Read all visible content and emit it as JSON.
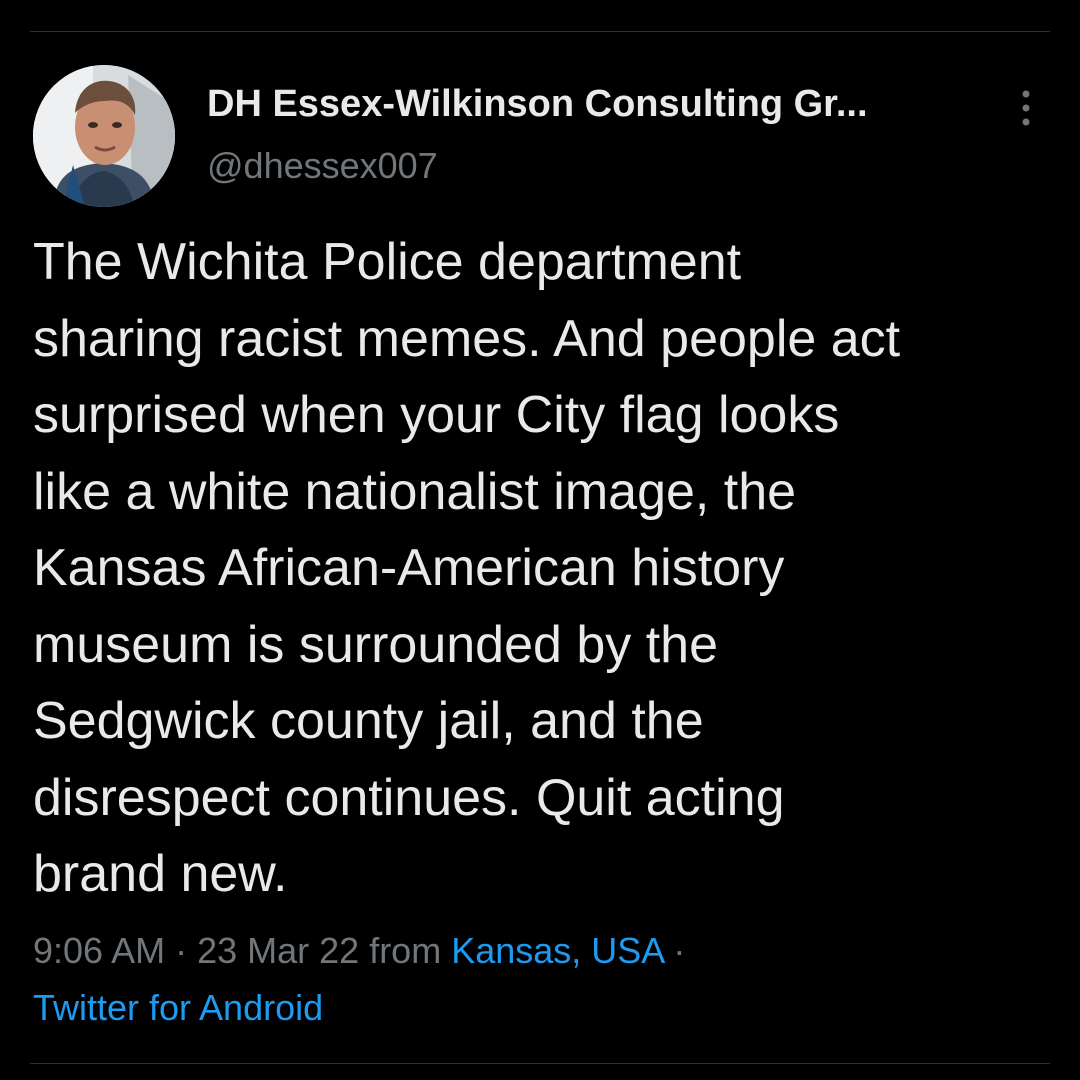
{
  "tweet": {
    "author": {
      "display_name": "DH Essex-Wilkinson Consulting Gr...",
      "handle": "@dhessex007",
      "avatar_icon": "user-avatar-photo"
    },
    "more_icon": "vertical-ellipsis-icon",
    "text": "The Wichita Police department\nsharing racist memes. And people act\nsurprised when your City flag looks\nlike a white nationalist image, the\nKansas African-American history\nmuseum is surrounded by the\nSedgwick county jail, and the\ndisrespect continues. Quit acting\nbrand new.",
    "meta": {
      "time": "9:06 AM",
      "separator": " · ",
      "date": "23 Mar 22",
      "from_text": " from ",
      "location": "Kansas, USA",
      "trailing_separator": " ·",
      "source": "Twitter for Android"
    }
  },
  "colors": {
    "background": "#000000",
    "primary_text": "#e7e9ea",
    "secondary_text": "#71767b",
    "link": "#1d9bf0",
    "divider": "#2f3336"
  }
}
